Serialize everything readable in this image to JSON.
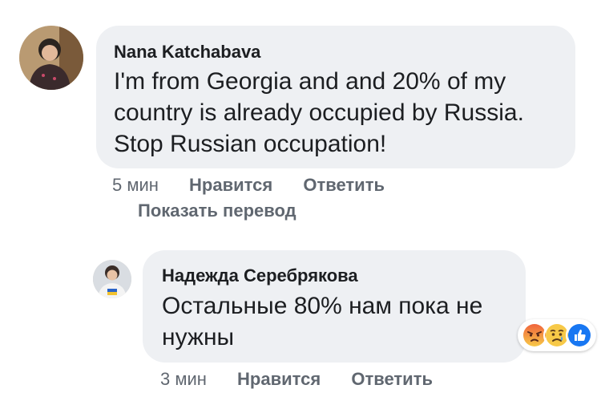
{
  "comments": [
    {
      "author": "Nana Katchabava",
      "text_lines": [
        "I'm from Georgia and and 20% of my",
        "country is already occupied by Russia.",
        "Stop Russian occupation!"
      ],
      "time": "5 мин",
      "like": "Нравится",
      "reply": "Ответить",
      "translate": "Показать перевод"
    },
    {
      "author": "Надежда Серебрякова",
      "text_lines": [
        "Остальные 80% нам пока не",
        "нужны"
      ],
      "time": "3 мин",
      "like": "Нравится",
      "reply": "Ответить",
      "reactions": [
        "angry-icon",
        "sad-icon",
        "like-icon"
      ]
    }
  ],
  "colors": {
    "bubble": "#eef0f3",
    "angry": "#f0643c",
    "sad": "#f7c948",
    "like": "#1877f2"
  }
}
